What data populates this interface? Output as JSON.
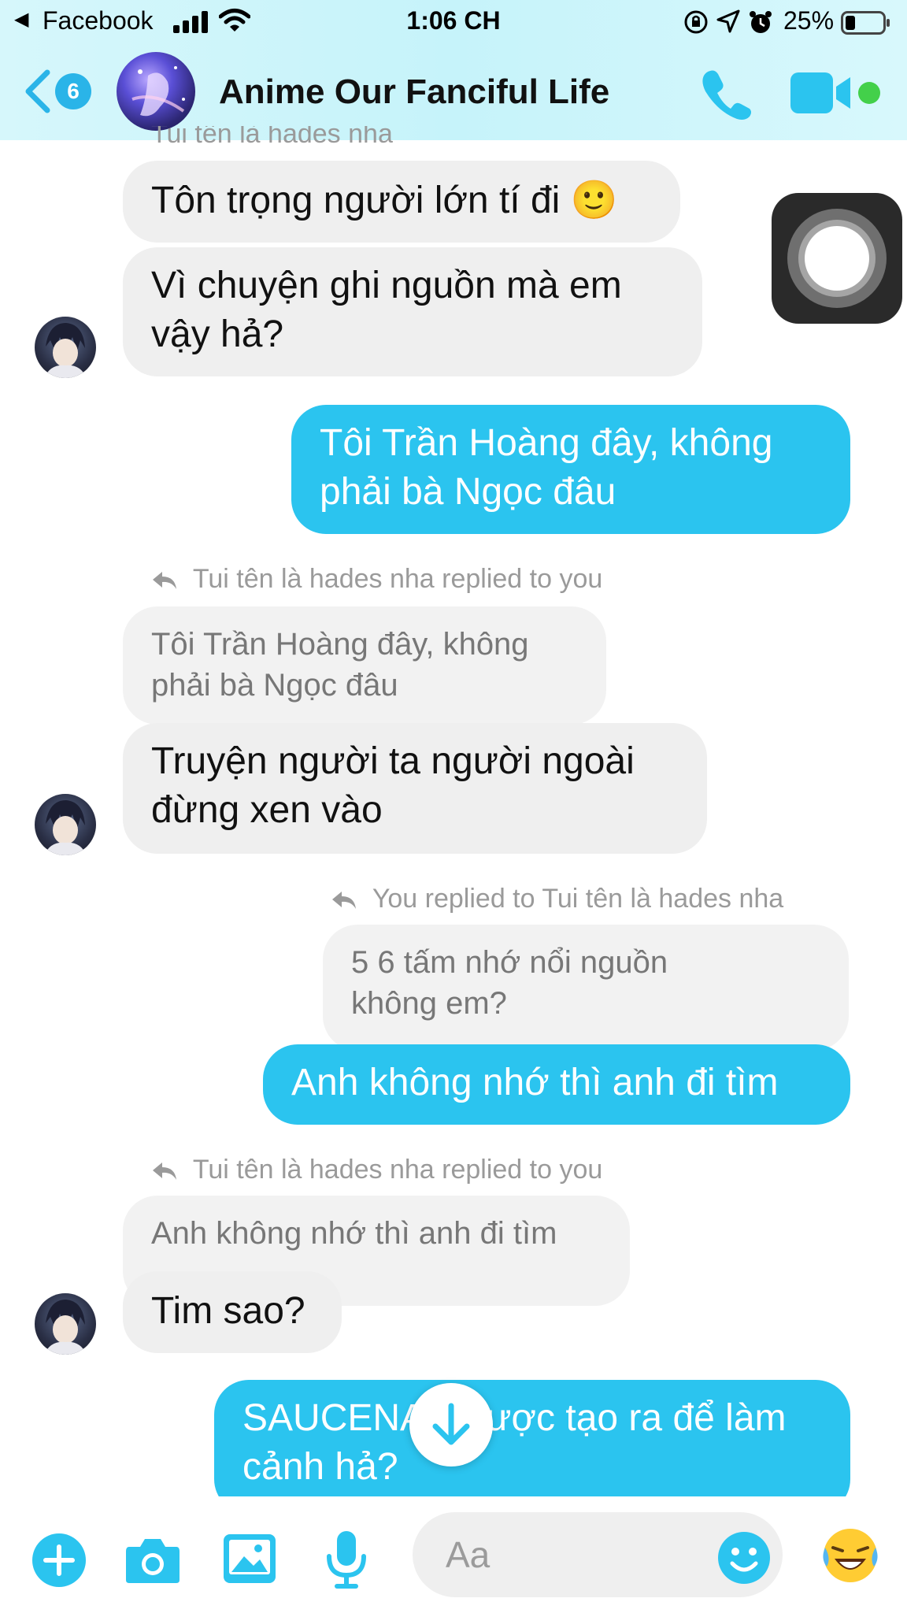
{
  "status_bar": {
    "back_label": "◀",
    "app": "Facebook",
    "time": "1:06 CH",
    "battery": "25%"
  },
  "header": {
    "unread_count": "6",
    "group_name": "Anime Our Fanciful Life"
  },
  "messages": {
    "cut_meta": "Tui tên là hades nha",
    "m1": "Tôn trọng người lớn tí đi 🙂",
    "m2_line1": "Vì chuyện ghi nguồn mà em",
    "m2_line2": "vậy hả?",
    "m3_line1": "Tôi Trần Hoàng đây, không",
    "m3_line2": "phải bà Ngọc đâu",
    "meta1": "Tui tên là hades nha replied to you",
    "q1_line1": "Tôi Trần Hoàng đây, không",
    "q1_line2": "phải bà Ngọc đâu",
    "m4_line1": "Truyện người ta người ngoài",
    "m4_line2": "đừng xen vào",
    "meta2": "You replied to Tui tên là hades nha",
    "q2_line1": "5 6 tấm nhớ nổi nguồn",
    "q2_line2": "không em?",
    "m5": "Anh không nhớ thì anh đi tìm",
    "meta3": "Tui tên là hades nha replied to you",
    "q3": "Anh không nhớ thì anh đi tìm",
    "m6": "Tim sao?",
    "m7_line1": "SAUCENAO được tạo ra để làm",
    "m7_line2": "cảnh hả?"
  },
  "composer": {
    "placeholder": "Aa"
  },
  "colors": {
    "accent": "#2bc4ef",
    "incoming_bubble": "#efefef",
    "active": "#43d04a"
  },
  "icons": [
    "signal-icon",
    "wifi-icon",
    "lock-rotation-icon",
    "location-icon",
    "alarm-icon",
    "battery-icon",
    "back-chevron-icon",
    "phone-icon",
    "video-camera-icon",
    "plus-icon",
    "camera-icon",
    "image-icon",
    "microphone-icon",
    "smiley-icon",
    "laughing-emoji-icon",
    "arrow-down-icon",
    "reply-arrow-icon"
  ]
}
